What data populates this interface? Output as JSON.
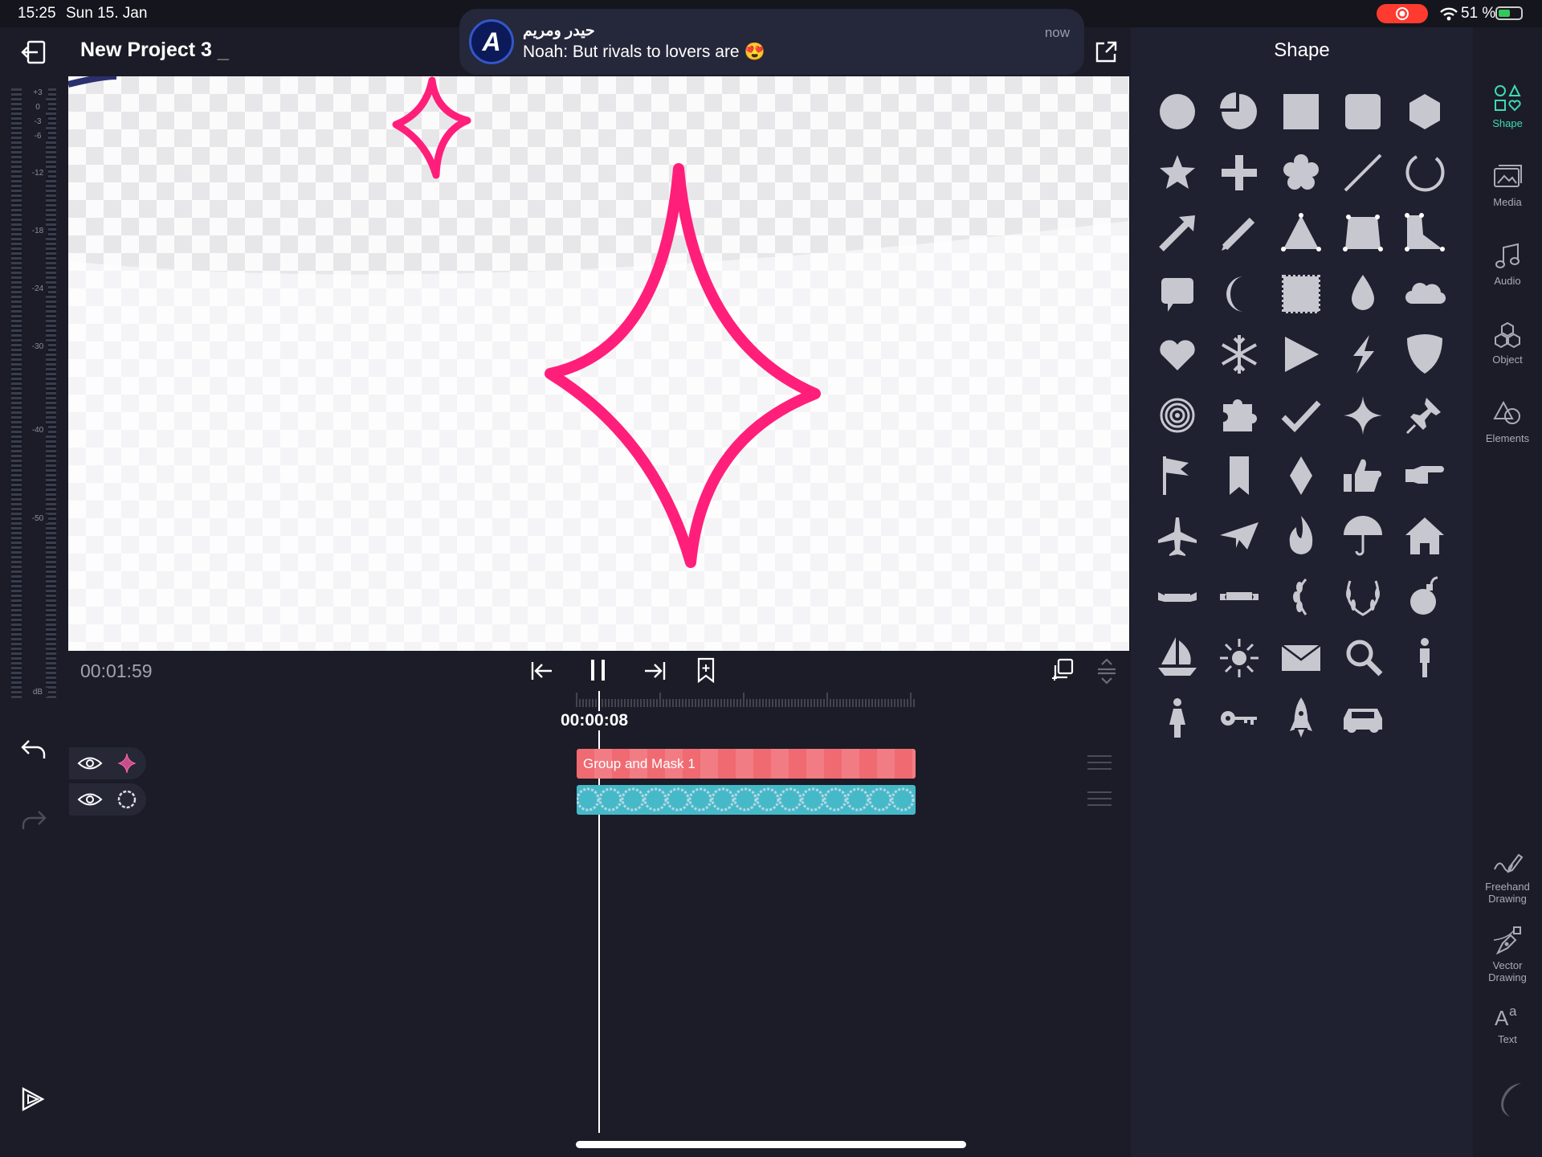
{
  "status_bar": {
    "time": "15:25",
    "date": "Sun 15. Jan",
    "battery": "51 %"
  },
  "header": {
    "project_title": "New Project 3"
  },
  "notification": {
    "title": "حيدر ومريم",
    "body": "Noah: But rivals to lovers are 😍",
    "time": "now"
  },
  "meter": {
    "ticks": [
      "+3",
      "0",
      "-3",
      "-6",
      "-12",
      "-18",
      "-24",
      "-30",
      "-40",
      "-50",
      "dB"
    ]
  },
  "transport": {
    "duration": "00:01:59",
    "current_time": "00:00:08"
  },
  "timeline": {
    "clip1_label": "Group and Mask 1"
  },
  "shape_panel": {
    "title": "Shape",
    "shapes": [
      "circle",
      "pie",
      "square",
      "rounded-square",
      "hexagon",
      "star",
      "cross",
      "flower",
      "line",
      "arc",
      "arrow",
      "pencil",
      "triangle",
      "trapezoid",
      "l-shape",
      "speech-bubble",
      "crescent",
      "stamp",
      "drop",
      "cloud",
      "heart",
      "snowflake",
      "play",
      "lightning",
      "shield",
      "spiral",
      "puzzle",
      "checkmark",
      "sparkle",
      "pushpin",
      "flag",
      "bookmark",
      "diamond",
      "thumbs-up",
      "pointing-hand",
      "airplane",
      "paper-plane",
      "fire",
      "umbrella",
      "house",
      "banner",
      "ribbon",
      "laurel-left",
      "laurel-wreath",
      "bomb",
      "sailboat",
      "sun",
      "envelope",
      "magnifier",
      "man",
      "woman",
      "key",
      "rocket",
      "car"
    ]
  },
  "right_toolbar": {
    "shape": "Shape",
    "media": "Media",
    "audio": "Audio",
    "object": "Object",
    "elements": "Elements",
    "freehand_1": "Freehand",
    "freehand_2": "Drawing",
    "vector_1": "Vector",
    "vector_2": "Drawing",
    "text": "Text"
  },
  "colors": {
    "accent": "#3fd9b5",
    "sparkle": "#ff1f7a",
    "clip_red": "#f06a72",
    "clip_teal": "#46b9c9"
  }
}
